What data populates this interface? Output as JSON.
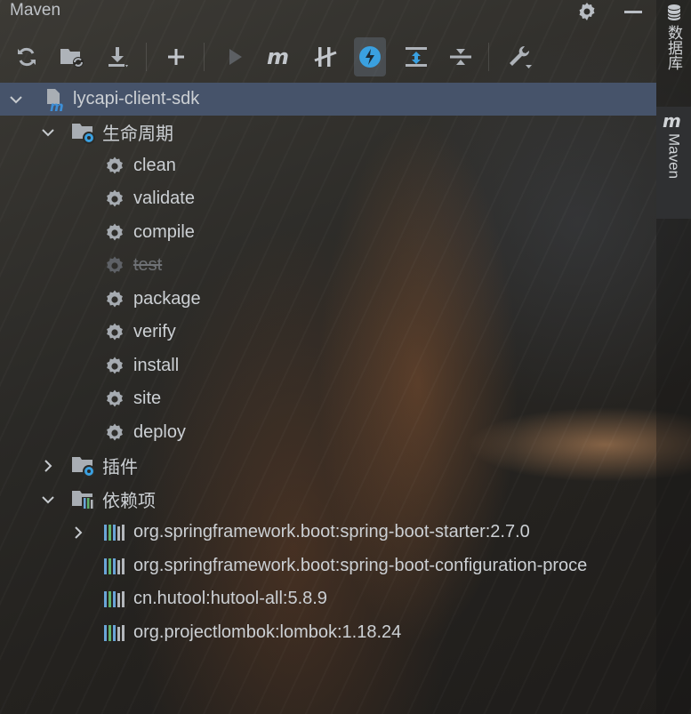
{
  "panel": {
    "title": "Maven"
  },
  "toolbar": {
    "buttons": [
      {
        "name": "reload",
        "icon": "refresh-icon"
      },
      {
        "name": "add-project",
        "icon": "folder-refresh-icon"
      },
      {
        "name": "download-sources",
        "icon": "download-icon"
      },
      {
        "name": "add",
        "icon": "plus-icon"
      },
      {
        "name": "run",
        "icon": "run-icon"
      },
      {
        "name": "execute-goal",
        "icon": "maven-m-icon"
      },
      {
        "name": "toggle-offline",
        "icon": "offline-icon"
      },
      {
        "name": "skip-tests",
        "icon": "skip-tests-icon",
        "active": true
      },
      {
        "name": "show-dependencies",
        "icon": "expand-icon"
      },
      {
        "name": "collapse-all",
        "icon": "collapse-icon"
      },
      {
        "name": "settings",
        "icon": "wrench-icon"
      }
    ]
  },
  "tree": {
    "project": "lycapi-client-sdk",
    "lifecycle": {
      "label": "生命周期",
      "goals": [
        "clean",
        "validate",
        "compile",
        "test",
        "package",
        "verify",
        "install",
        "site",
        "deploy"
      ],
      "disabled": [
        "test"
      ]
    },
    "plugins": {
      "label": "插件"
    },
    "dependencies": {
      "label": "依赖项",
      "items": [
        "org.springframework.boot:spring-boot-starter:2.7.0",
        "org.springframework.boot:spring-boot-configuration-proce",
        "cn.hutool:hutool-all:5.8.9",
        "org.projectlombok:lombok:1.18.24"
      ]
    }
  },
  "right_strip": {
    "database_label": "数据库",
    "maven_label": "Maven"
  },
  "colors": {
    "selection": "#46536a",
    "icon_gray": "#aeb3b9",
    "accent_blue": "#3aa0e0",
    "maven_blue": "#3d8fd8"
  }
}
